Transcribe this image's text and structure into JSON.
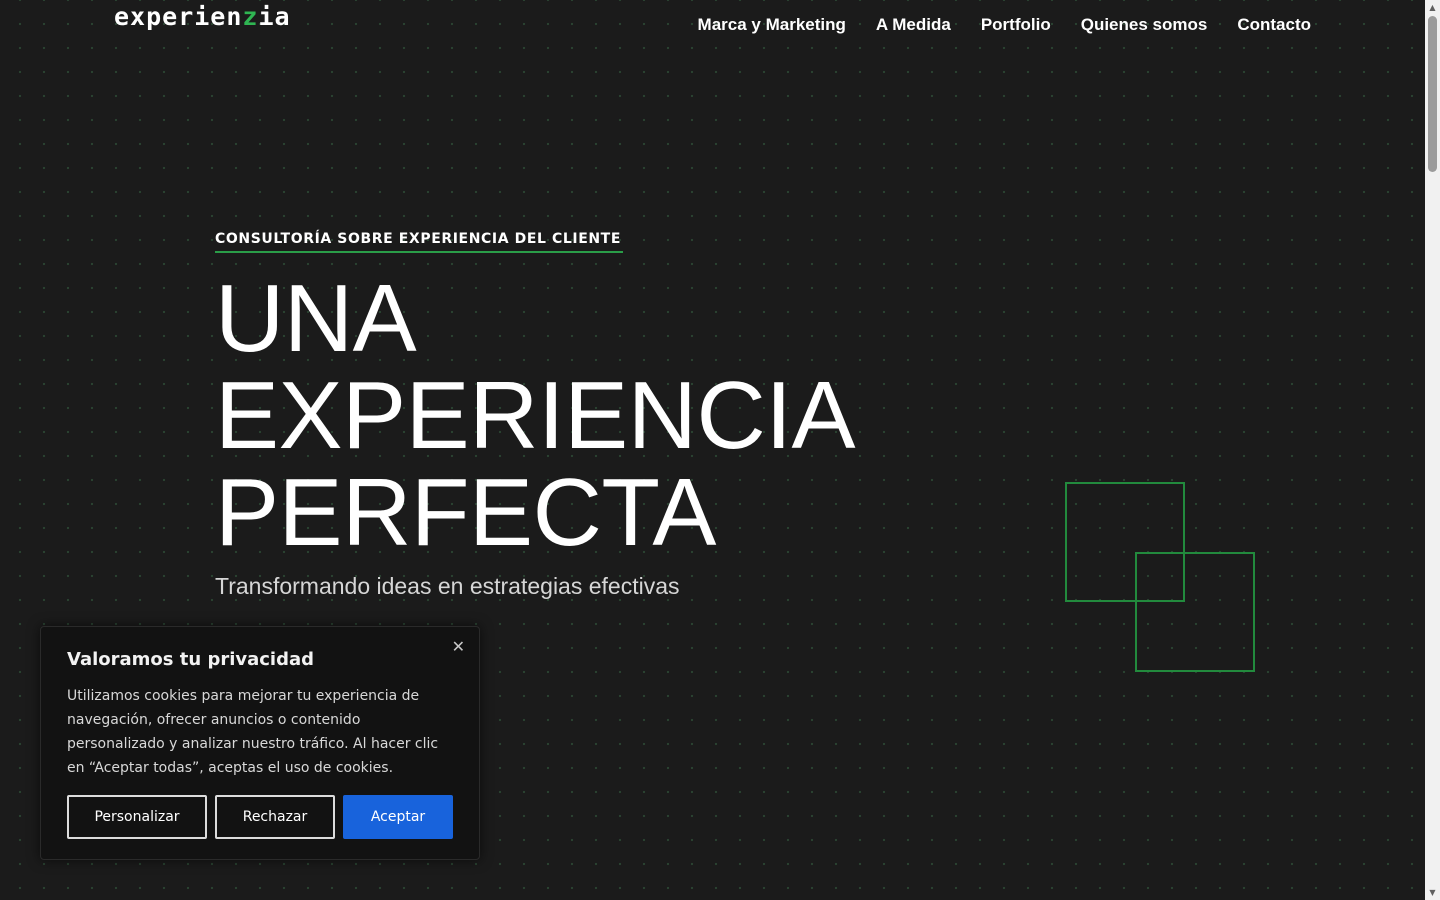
{
  "header": {
    "logo_part1": "experien",
    "logo_accent": "z",
    "logo_part2": "ia",
    "nav": [
      {
        "label": "Marca y Marketing"
      },
      {
        "label": "A Medida"
      },
      {
        "label": "Portfolio"
      },
      {
        "label": "Quienes somos"
      },
      {
        "label": "Contacto"
      }
    ]
  },
  "hero": {
    "eyebrow": "CONSULTORÍA SOBRE EXPERIENCIA DEL CLIENTE",
    "title_lines": [
      "UNA",
      "EXPERIENCIA",
      "PERFECTA"
    ],
    "subtitle": "Transformando ideas en estrategias efectivas"
  },
  "cookie_banner": {
    "close_icon": "close-icon",
    "title": "Valoramos tu privacidad",
    "text": "Utilizamos cookies para mejorar tu experiencia de navegación, ofrecer anuncios o contenido personalizado y analizar nuestro tráfico. Al hacer clic en “Aceptar todas”, aceptas el uso de cookies.",
    "customize_label": "Personalizar",
    "reject_label": "Rechazar",
    "accept_label": "Aceptar"
  },
  "colors": {
    "background": "#1b1b1b",
    "accent_green": "#2fb552",
    "accept_blue": "#1863dc"
  }
}
